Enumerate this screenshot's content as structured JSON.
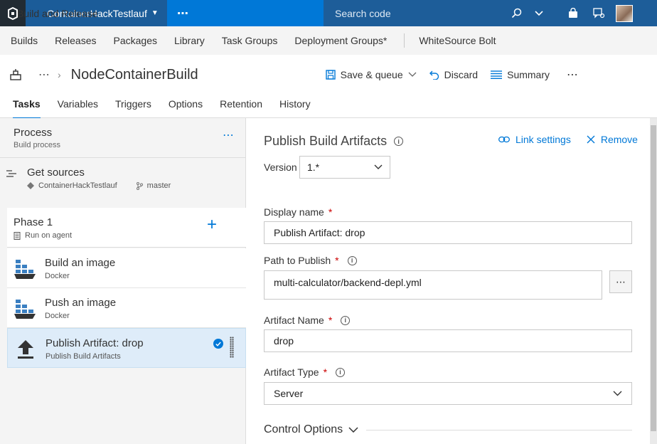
{
  "topbar": {
    "project": "ContainerHackTestlauf",
    "hub": "Build and Release",
    "hub_more": "⋯",
    "search_placeholder": "Search code"
  },
  "subnav": [
    "Builds",
    "Releases",
    "Packages",
    "Library",
    "Task Groups",
    "Deployment Groups*"
  ],
  "subnav_extension": "WhiteSource Bolt",
  "titlebar": {
    "breadcrumb_more": "⋯",
    "title": "NodeContainerBuild",
    "save_queue": "Save & queue",
    "discard": "Discard",
    "summary": "Summary",
    "more": "⋯"
  },
  "tabs": [
    "Tasks",
    "Variables",
    "Triggers",
    "Options",
    "Retention",
    "History"
  ],
  "process": {
    "title": "Process",
    "subtitle": "Build process",
    "more": "⋯"
  },
  "get_sources": {
    "title": "Get sources",
    "repo": "ContainerHackTestlauf",
    "branch": "master"
  },
  "phase": {
    "title": "Phase 1",
    "subtitle": "Run on agent",
    "add": "+"
  },
  "tasks": [
    {
      "title": "Build an image",
      "subtitle": "Docker"
    },
    {
      "title": "Push an image",
      "subtitle": "Docker"
    },
    {
      "title": "Publish Artifact: drop",
      "subtitle": "Publish Build Artifacts"
    }
  ],
  "detail": {
    "title": "Publish Build Artifacts",
    "link_settings": "Link settings",
    "remove": "Remove",
    "version_label": "Version",
    "version_value": "1.*",
    "display_name_label": "Display name",
    "display_name_value": "Publish Artifact: drop",
    "path_label": "Path to Publish",
    "path_value": "multi-calculator/backend-depl.yml",
    "path_browse": "⋯",
    "artifact_name_label": "Artifact Name",
    "artifact_name_value": "drop",
    "artifact_type_label": "Artifact Type",
    "artifact_type_value": "Server",
    "required_mark": "*",
    "info_mark": "i",
    "control_options": "Control Options"
  },
  "colors": {
    "accent": "#0078d7",
    "topbar": "#1d5d99",
    "logo_bg": "#222b33",
    "selected_row": "#deecf9"
  }
}
